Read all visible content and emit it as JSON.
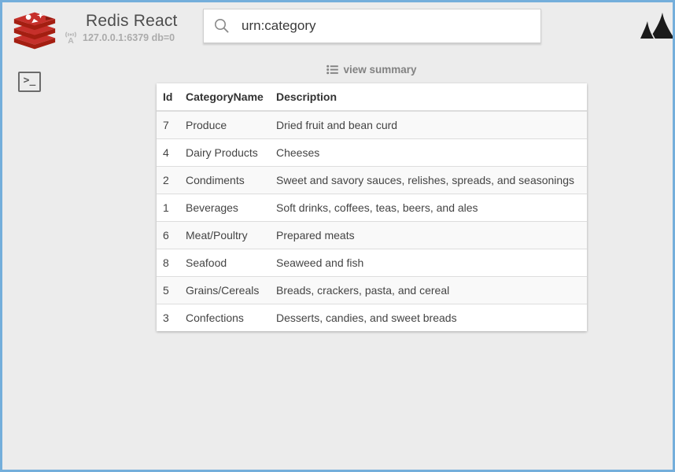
{
  "header": {
    "app_title": "Redis React",
    "connection_info": "127.0.0.1:6379 db=0",
    "search_value": "urn:category"
  },
  "sidebar": {
    "terminal_glyph": ">_"
  },
  "main": {
    "summary_link_label": "view summary",
    "table": {
      "columns": [
        "Id",
        "CategoryName",
        "Description"
      ],
      "rows": [
        {
          "id": "7",
          "name": "Produce",
          "description": "Dried fruit and bean curd"
        },
        {
          "id": "4",
          "name": "Dairy Products",
          "description": "Cheeses"
        },
        {
          "id": "2",
          "name": "Condiments",
          "description": "Sweet and savory sauces, relishes, spreads, and seasonings"
        },
        {
          "id": "1",
          "name": "Beverages",
          "description": "Soft drinks, coffees, teas, beers, and ales"
        },
        {
          "id": "6",
          "name": "Meat/Poultry",
          "description": "Prepared meats"
        },
        {
          "id": "8",
          "name": "Seafood",
          "description": "Seaweed and fish"
        },
        {
          "id": "5",
          "name": "Grains/Cereals",
          "description": "Breads, crackers, pasta, and cereal"
        },
        {
          "id": "3",
          "name": "Confections",
          "description": "Desserts, candies, and sweet breads"
        }
      ]
    }
  },
  "icons": {
    "logo": "redis-logo",
    "antenna": "antenna-icon",
    "search": "search-icon",
    "shark_fin": "shark-fin-icon",
    "terminal": "terminal-icon",
    "list": "list-icon"
  },
  "colors": {
    "frame_border": "#74aedb",
    "background": "#ececec",
    "redis_red": "#c6302b",
    "redis_dark_red": "#a41e11",
    "table_stripe": "#f9f9f9",
    "row_border": "#dddddd",
    "fin_black": "#1b1b1b"
  }
}
